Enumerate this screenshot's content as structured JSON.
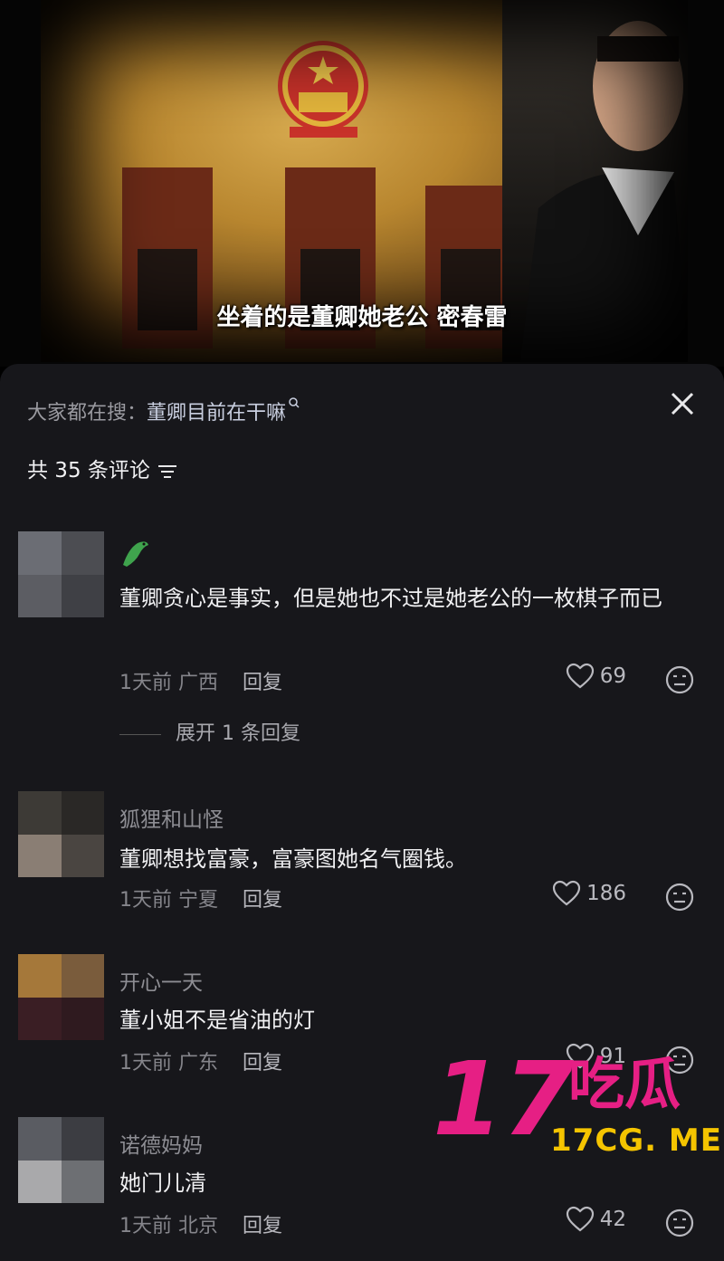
{
  "video": {
    "caption": "坐着的是董卿她老公 密春雷"
  },
  "sheet": {
    "search_prefix": "大家都在搜：",
    "search_term": "董卿目前在干嘛",
    "comment_count_label": "共 35 条评论"
  },
  "comments": [
    {
      "username": "",
      "text": "董卿贪心是事实，但是她也不过是她老公的一枚棋子而已",
      "time": "1天前",
      "location": "广西",
      "reply_label": "回复",
      "likes": "69",
      "expand_label": "展开 1 条回复",
      "badge_icon": "crocodile-icon"
    },
    {
      "username": "狐狸和山怪",
      "text": "董卿想找富豪，富豪图她名气圈钱。",
      "time": "1天前",
      "location": "宁夏",
      "reply_label": "回复",
      "likes": "186"
    },
    {
      "username": "开心一天",
      "text": "董小姐不是省油的灯",
      "time": "1天前",
      "location": "广东",
      "reply_label": "回复",
      "likes": "91"
    },
    {
      "username": "诺德妈妈",
      "text": "她门儿清",
      "time": "1天前",
      "location": "北京",
      "reply_label": "回复",
      "likes": "42"
    }
  ],
  "watermark": {
    "number": "17",
    "name": "吃瓜",
    "url": "17CG. ME"
  },
  "colors": {
    "sheet_bg": "#17171b",
    "watermark_pink": "#e61f84",
    "watermark_yellow": "#f5c400"
  }
}
